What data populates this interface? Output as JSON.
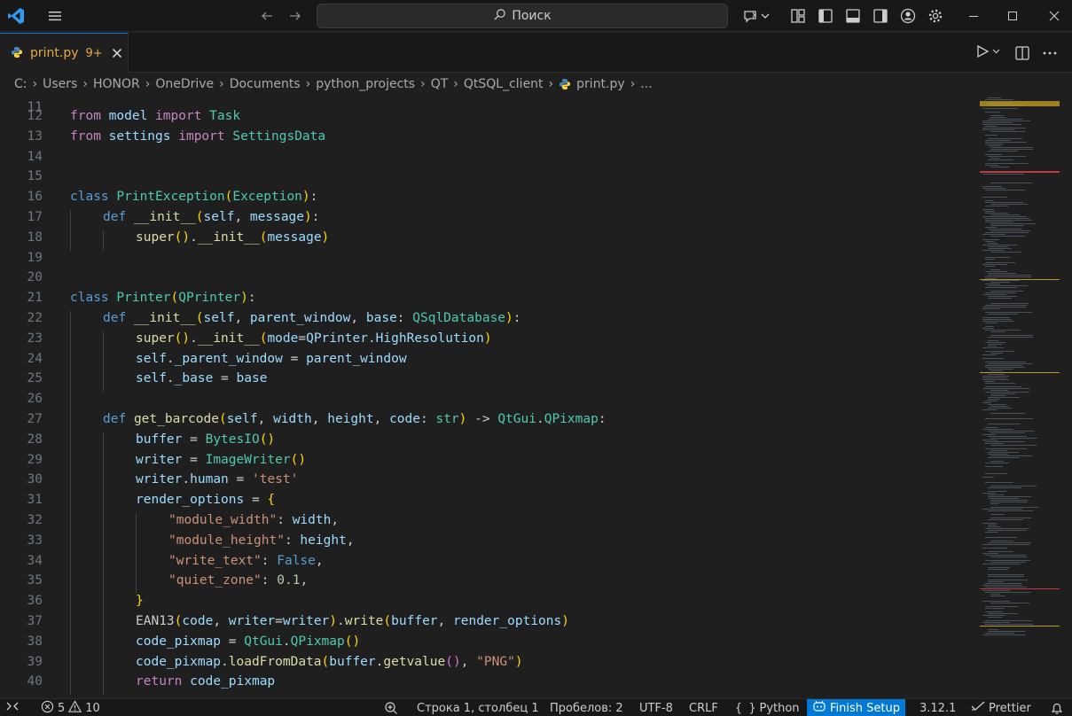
{
  "titlebar": {
    "search_label": "Поиск"
  },
  "tab": {
    "name": "print.py",
    "badge": "9+"
  },
  "breadcrumb": [
    "C:",
    "Users",
    "HONOR",
    "OneDrive",
    "Documents",
    "python_projects",
    "QT",
    "QtSQL_client",
    "print.py",
    "..."
  ],
  "code": {
    "first_line_number": "11",
    "lines": [
      {
        "n": "12",
        "indent": 0,
        "tokens": [
          [
            "kw2",
            "from"
          ],
          [
            "pl",
            " "
          ],
          [
            "var",
            "model"
          ],
          [
            "pl",
            " "
          ],
          [
            "kw2",
            "import"
          ],
          [
            "pl",
            " "
          ],
          [
            "cls",
            "Task"
          ]
        ]
      },
      {
        "n": "13",
        "indent": 0,
        "tokens": [
          [
            "kw2",
            "from"
          ],
          [
            "pl",
            " "
          ],
          [
            "var",
            "settings"
          ],
          [
            "pl",
            " "
          ],
          [
            "kw2",
            "import"
          ],
          [
            "pl",
            " "
          ],
          [
            "cls",
            "SettingsData"
          ]
        ]
      },
      {
        "n": "14",
        "indent": 0,
        "tokens": []
      },
      {
        "n": "15",
        "indent": 0,
        "tokens": []
      },
      {
        "n": "16",
        "indent": 0,
        "tokens": [
          [
            "kw",
            "class"
          ],
          [
            "pl",
            " "
          ],
          [
            "cls",
            "PrintException"
          ],
          [
            "br1",
            "("
          ],
          [
            "cls",
            "Exception"
          ],
          [
            "br1",
            ")"
          ],
          [
            "pl",
            ":"
          ]
        ]
      },
      {
        "n": "17",
        "indent": 1,
        "tokens": [
          [
            "kw",
            "def"
          ],
          [
            "pl",
            " "
          ],
          [
            "fn",
            "__init__"
          ],
          [
            "br1",
            "("
          ],
          [
            "var",
            "self"
          ],
          [
            "pl",
            ", "
          ],
          [
            "var",
            "message"
          ],
          [
            "br1",
            ")"
          ],
          [
            "pl",
            ":"
          ]
        ]
      },
      {
        "n": "18",
        "indent": 2,
        "tokens": [
          [
            "fn",
            "super"
          ],
          [
            "br1",
            "()"
          ],
          [
            "pl",
            "."
          ],
          [
            "fn",
            "__init__"
          ],
          [
            "br1",
            "("
          ],
          [
            "var",
            "message"
          ],
          [
            "br1",
            ")"
          ]
        ]
      },
      {
        "n": "19",
        "indent": 0,
        "tokens": []
      },
      {
        "n": "20",
        "indent": 0,
        "tokens": []
      },
      {
        "n": "21",
        "indent": 0,
        "tokens": [
          [
            "kw",
            "class"
          ],
          [
            "pl",
            " "
          ],
          [
            "cls",
            "Printer"
          ],
          [
            "br1",
            "("
          ],
          [
            "cls",
            "QPrinter"
          ],
          [
            "br1",
            ")"
          ],
          [
            "pl",
            ":"
          ]
        ]
      },
      {
        "n": "22",
        "indent": 1,
        "tokens": [
          [
            "kw",
            "def"
          ],
          [
            "pl",
            " "
          ],
          [
            "fn",
            "__init__"
          ],
          [
            "br1",
            "("
          ],
          [
            "var",
            "self"
          ],
          [
            "pl",
            ", "
          ],
          [
            "var",
            "parent_window"
          ],
          [
            "pl",
            ", "
          ],
          [
            "var",
            "base"
          ],
          [
            "pl",
            ": "
          ],
          [
            "cls",
            "QSqlDatabase"
          ],
          [
            "br1",
            ")"
          ],
          [
            "pl",
            ":"
          ]
        ]
      },
      {
        "n": "23",
        "indent": 2,
        "tokens": [
          [
            "fn",
            "super"
          ],
          [
            "br1",
            "()"
          ],
          [
            "pl",
            "."
          ],
          [
            "fn",
            "__init__"
          ],
          [
            "br1",
            "("
          ],
          [
            "var",
            "mode"
          ],
          [
            "pl",
            "="
          ],
          [
            "var",
            "QPrinter"
          ],
          [
            "pl",
            "."
          ],
          [
            "var",
            "HighResolution"
          ],
          [
            "br1",
            ")"
          ]
        ]
      },
      {
        "n": "24",
        "indent": 2,
        "tokens": [
          [
            "var",
            "self"
          ],
          [
            "pl",
            "."
          ],
          [
            "var",
            "_parent_window"
          ],
          [
            "pl",
            " = "
          ],
          [
            "var",
            "parent_window"
          ]
        ]
      },
      {
        "n": "25",
        "indent": 2,
        "tokens": [
          [
            "var",
            "self"
          ],
          [
            "pl",
            "."
          ],
          [
            "var",
            "_base"
          ],
          [
            "pl",
            " = "
          ],
          [
            "var",
            "base"
          ]
        ]
      },
      {
        "n": "26",
        "indent": 1,
        "tokens": []
      },
      {
        "n": "27",
        "indent": 1,
        "tokens": [
          [
            "kw",
            "def"
          ],
          [
            "pl",
            " "
          ],
          [
            "fn",
            "get_barcode"
          ],
          [
            "br1",
            "("
          ],
          [
            "var",
            "self"
          ],
          [
            "pl",
            ", "
          ],
          [
            "var",
            "width"
          ],
          [
            "pl",
            ", "
          ],
          [
            "var",
            "height"
          ],
          [
            "pl",
            ", "
          ],
          [
            "var",
            "code"
          ],
          [
            "pl",
            ": "
          ],
          [
            "cls",
            "str"
          ],
          [
            "br1",
            ")"
          ],
          [
            "pl",
            " -> "
          ],
          [
            "cls",
            "QtGui"
          ],
          [
            "pl",
            "."
          ],
          [
            "cls",
            "QPixmap"
          ],
          [
            "pl",
            ":"
          ]
        ]
      },
      {
        "n": "28",
        "indent": 2,
        "tokens": [
          [
            "var",
            "buffer"
          ],
          [
            "pl",
            " = "
          ],
          [
            "cls",
            "BytesIO"
          ],
          [
            "br1",
            "()"
          ]
        ]
      },
      {
        "n": "29",
        "indent": 2,
        "tokens": [
          [
            "var",
            "writer"
          ],
          [
            "pl",
            " = "
          ],
          [
            "cls",
            "ImageWriter"
          ],
          [
            "br1",
            "()"
          ]
        ]
      },
      {
        "n": "30",
        "indent": 2,
        "tokens": [
          [
            "var",
            "writer"
          ],
          [
            "pl",
            "."
          ],
          [
            "var",
            "human"
          ],
          [
            "pl",
            " = "
          ],
          [
            "str",
            "'test'"
          ]
        ]
      },
      {
        "n": "31",
        "indent": 2,
        "tokens": [
          [
            "var",
            "render_options"
          ],
          [
            "pl",
            " = "
          ],
          [
            "br1",
            "{"
          ]
        ]
      },
      {
        "n": "32",
        "indent": 3,
        "tokens": [
          [
            "str",
            "\"module_width\""
          ],
          [
            "pl",
            ": "
          ],
          [
            "var",
            "width"
          ],
          [
            "pl",
            ","
          ]
        ]
      },
      {
        "n": "33",
        "indent": 3,
        "tokens": [
          [
            "str",
            "\"module_height\""
          ],
          [
            "pl",
            ": "
          ],
          [
            "var",
            "height"
          ],
          [
            "pl",
            ","
          ]
        ]
      },
      {
        "n": "34",
        "indent": 3,
        "tokens": [
          [
            "str",
            "\"write_text\""
          ],
          [
            "pl",
            ": "
          ],
          [
            "kw",
            "False"
          ],
          [
            "pl",
            ","
          ]
        ]
      },
      {
        "n": "35",
        "indent": 3,
        "tokens": [
          [
            "str",
            "\"quiet_zone\""
          ],
          [
            "pl",
            ": "
          ],
          [
            "num",
            "0.1"
          ],
          [
            "pl",
            ","
          ]
        ]
      },
      {
        "n": "36",
        "indent": 2,
        "tokens": [
          [
            "br1",
            "}"
          ]
        ]
      },
      {
        "n": "37",
        "indent": 2,
        "tokens": [
          [
            "pl",
            "EAN13"
          ],
          [
            "br1",
            "("
          ],
          [
            "var",
            "code"
          ],
          [
            "pl",
            ", "
          ],
          [
            "var",
            "writer"
          ],
          [
            "pl",
            "="
          ],
          [
            "var",
            "writer"
          ],
          [
            "br1",
            ")"
          ],
          [
            "pl",
            "."
          ],
          [
            "fn",
            "write"
          ],
          [
            "br1",
            "("
          ],
          [
            "var",
            "buffer"
          ],
          [
            "pl",
            ", "
          ],
          [
            "var",
            "render_options"
          ],
          [
            "br1",
            ")"
          ]
        ]
      },
      {
        "n": "38",
        "indent": 2,
        "tokens": [
          [
            "var",
            "code_pixmap"
          ],
          [
            "pl",
            " = "
          ],
          [
            "cls",
            "QtGui"
          ],
          [
            "pl",
            "."
          ],
          [
            "cls",
            "QPixmap"
          ],
          [
            "br1",
            "()"
          ]
        ]
      },
      {
        "n": "39",
        "indent": 2,
        "tokens": [
          [
            "var",
            "code_pixmap"
          ],
          [
            "pl",
            "."
          ],
          [
            "fn",
            "loadFromData"
          ],
          [
            "br1",
            "("
          ],
          [
            "var",
            "buffer"
          ],
          [
            "pl",
            "."
          ],
          [
            "fn",
            "getvalue"
          ],
          [
            "br2",
            "()"
          ],
          [
            "pl",
            ", "
          ],
          [
            "str",
            "\"PNG\""
          ],
          [
            "br1",
            ")"
          ]
        ]
      },
      {
        "n": "40",
        "indent": 2,
        "tokens": [
          [
            "kw2",
            "return"
          ],
          [
            "pl",
            " "
          ],
          [
            "var",
            "code_pixmap"
          ]
        ]
      }
    ]
  },
  "statusbar": {
    "errors": "5",
    "warnings": "10",
    "cursor": "Строка 1, столбец 1",
    "spaces": "Пробелов: 2",
    "encoding": "UTF-8",
    "eol": "CRLF",
    "language": "Python",
    "finish_setup": "Finish Setup",
    "python_version": "3.12.1",
    "prettier": "Prettier"
  },
  "colors": {
    "accent": "#0078d4",
    "tab_modified": "#e5a84e",
    "keyword": "#569cd6",
    "control": "#c586c0",
    "class": "#4ec9b0",
    "function": "#dcdcaa",
    "variable": "#9cdcfe",
    "string": "#ce9178",
    "number": "#b5cea8"
  }
}
